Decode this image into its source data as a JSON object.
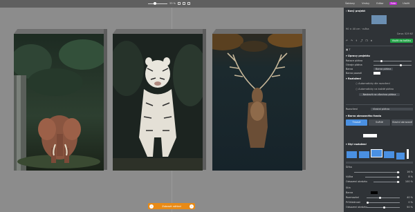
{
  "topbar": {
    "zoom_percent": "33 %",
    "nav_tabs": [
      {
        "label": "Šablony",
        "active": false
      },
      {
        "label": "Vrstvy",
        "active": false
      },
      {
        "label": "Editor",
        "active": false
      },
      {
        "label": "Foto",
        "active": true
      },
      {
        "label": "Uložit",
        "active": false
      }
    ]
  },
  "bottom_bar": {
    "label": "Zobrazit náhled"
  },
  "canvas": {
    "images": [
      {
        "subject": "elephant",
        "icon": "elephant-photo"
      },
      {
        "subject": "white tiger",
        "icon": "tiger-photo"
      },
      {
        "subject": "deer stag",
        "icon": "deer-photo"
      }
    ]
  },
  "panel": {
    "title": "Nový projekt",
    "dimensions": "90 × 40 cm · ručka",
    "price": "Cena: 529 Kč",
    "add_to_cart": "Vložit do košíku",
    "section_adjustments": "Úpravy projektu",
    "label_rotation": "Rotace plátna",
    "label_margin": "Okraje plátna",
    "label_color": "Barva",
    "color_value": "Barva plátna",
    "label_background": "Barva pozadí",
    "section_border": "Rozložení",
    "border_option_1": "Automaticky dle rozvržení",
    "border_option_2": "Automaticky na každé plátno",
    "apply_button": "Nastavit na všechna plátna",
    "preset_label": "Rozvržení",
    "preset_value": "Vlastní plátno",
    "section_background": "Barva obrazového fondu",
    "bg_option_1": "Tmavé",
    "bg_option_2": "Světlé",
    "bg_option_3": "Vlastní obrazové",
    "section_style": "Styl rozložení",
    "label_width": "Šířka",
    "label_height": "Výška",
    "label_offset": "Odsazení obrázku",
    "label_shadow": "Stín",
    "label_blur": "Rozmazání",
    "label_opacity": "Průhlednost",
    "label_color2": "Barva",
    "vals": [
      "16 %",
      "8 %",
      "100 %",
      "40 %",
      "0 %",
      "50 %",
      "16 %"
    ]
  },
  "colors": {
    "accent": "#c026d3",
    "green": "#22a447",
    "blue": "#4a90e2",
    "panel_bg": "#2f3337",
    "canvas_bg": "#8c8c8c"
  }
}
